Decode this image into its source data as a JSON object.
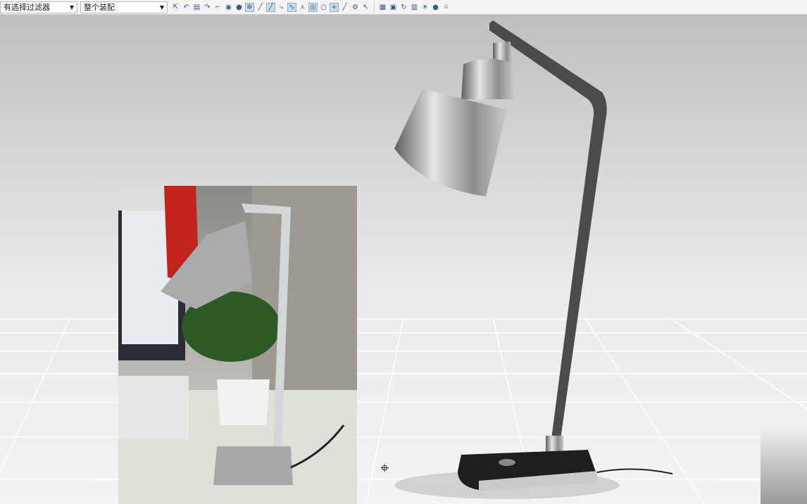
{
  "toolbar": {
    "filter_label": "有选择过滤器",
    "scope_label": "整个装配",
    "icons": [
      "selection-icon",
      "undo-icon",
      "save-icon",
      "redo-icon",
      "view-icon",
      "render-icon",
      "snap-icon",
      "line-icon",
      "curve-icon",
      "measure-icon",
      "point-icon",
      "grid-icon",
      "layer-icon",
      "light-icon",
      "camera-icon"
    ]
  },
  "viewport": {
    "background": "#e4e5e6",
    "floor_grid": true
  },
  "reference_photo": {
    "subject": "desk-lamp-photo"
  },
  "model": {
    "name": "desk-lamp-3d",
    "lamp_color": "#b9bbbd",
    "base_color": "#1e1e1e"
  }
}
